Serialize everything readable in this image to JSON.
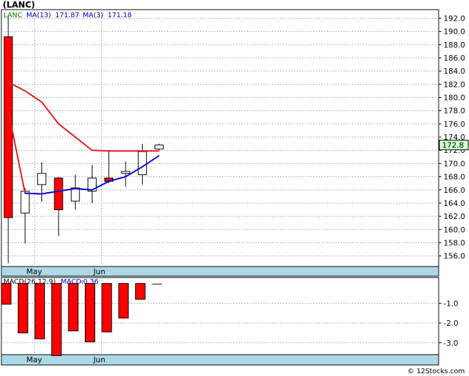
{
  "title": "(LANC)",
  "watermark": "© 12Stocks.com",
  "colors": {
    "up_fill": "#ffffff",
    "down_fill": "#ff0000",
    "candle_border": "#000000",
    "ma13": "#e31a1c",
    "ma3": "#0000e0",
    "macd": "#ff0000",
    "axis_band": "#add8e6",
    "grid": "#b0b0b0",
    "price_box": "#ccffcc"
  },
  "chart_data": [
    {
      "type": "candlestick",
      "legend": {
        "ticker": "LANC",
        "ma13_label": "MA(13)",
        "ma13_value": "171.87",
        "ma3_label": "MA(3)",
        "ma3_value": "171.18"
      },
      "current_price": "172.8",
      "y_ticks": [
        "192.0",
        "190.0",
        "188.0",
        "186.0",
        "184.0",
        "182.0",
        "180.0",
        "178.0",
        "176.0",
        "174.0",
        "172.0",
        "170.0",
        "168.0",
        "166.0",
        "164.0",
        "162.0",
        "160.0",
        "158.0",
        "156.0"
      ],
      "x_labels": [
        {
          "label": "May",
          "index": 1
        },
        {
          "label": "Jun",
          "index": 5
        }
      ],
      "ylim": [
        154.4,
        193.3
      ],
      "candles": [
        {
          "open": 189.2,
          "close": 161.8,
          "high": 192.3,
          "low": 154.9
        },
        {
          "open": 162.5,
          "close": 165.8,
          "high": 166.3,
          "low": 157.9
        },
        {
          "open": 166.8,
          "close": 168.5,
          "high": 170.2,
          "low": 164.2
        },
        {
          "open": 167.8,
          "close": 163.0,
          "high": 168.0,
          "low": 159.0
        },
        {
          "open": 164.3,
          "close": 166.3,
          "high": 168.3,
          "low": 163.0
        },
        {
          "open": 165.8,
          "close": 167.8,
          "high": 169.8,
          "low": 164.0
        },
        {
          "open": 167.8,
          "close": 167.3,
          "high": 172.0,
          "low": 167.0
        },
        {
          "open": 168.5,
          "close": 168.8,
          "high": 170.3,
          "low": 166.5
        },
        {
          "open": 168.3,
          "close": 171.8,
          "high": 173.0,
          "low": 166.8
        },
        {
          "open": 172.2,
          "close": 172.8,
          "high": 173.0,
          "low": 172.0
        }
      ],
      "ma13": [
        182.3,
        181.0,
        179.3,
        176.0,
        174.0,
        172.0,
        171.9,
        171.9,
        171.9,
        171.9
      ],
      "ma13_x": [
        0,
        1,
        2,
        3,
        4,
        5,
        6,
        7,
        8,
        9
      ],
      "ma13_start": 176.9,
      "ma3": [
        178.0,
        165.5,
        165.4,
        165.8,
        166.2,
        166.0,
        167.3,
        168.0,
        169.5,
        171.2
      ]
    },
    {
      "type": "bar",
      "legend": {
        "label": "MACD(26,12,9)",
        "value_label": "MACD:",
        "value": "-0.36"
      },
      "y_ticks": [
        "-1.0",
        "-2.0",
        "-3.0"
      ],
      "x_labels": [
        {
          "label": "May",
          "index": 1
        },
        {
          "label": "Jun",
          "index": 5
        }
      ],
      "ylim": [
        -3.6,
        0.3
      ],
      "values": [
        -1.05,
        -2.5,
        -2.8,
        -3.65,
        -2.4,
        -2.95,
        -2.45,
        -1.75,
        -0.8,
        -0.02
      ]
    }
  ]
}
